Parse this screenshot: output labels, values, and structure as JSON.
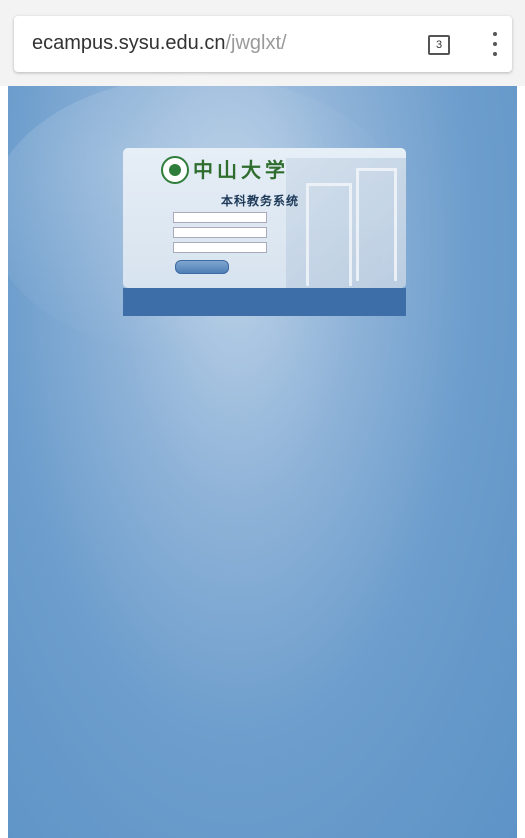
{
  "browser": {
    "url_host": "ecampus.sysu.edu.cn",
    "url_path": "/jwglxt/",
    "tab_count": "3",
    "menu_icon": "more-vert-icon"
  },
  "login": {
    "university_name": "中山大学",
    "system_name": "本科教务系统",
    "username_label": "",
    "password_label": "",
    "captcha_label": "",
    "captcha_text": "",
    "login_button": ""
  },
  "colors": {
    "page_background": "#5d93c7",
    "notice_band": "#3d6ea8",
    "notice_red": "#d62222",
    "brand_green": "#2f6d2e"
  }
}
